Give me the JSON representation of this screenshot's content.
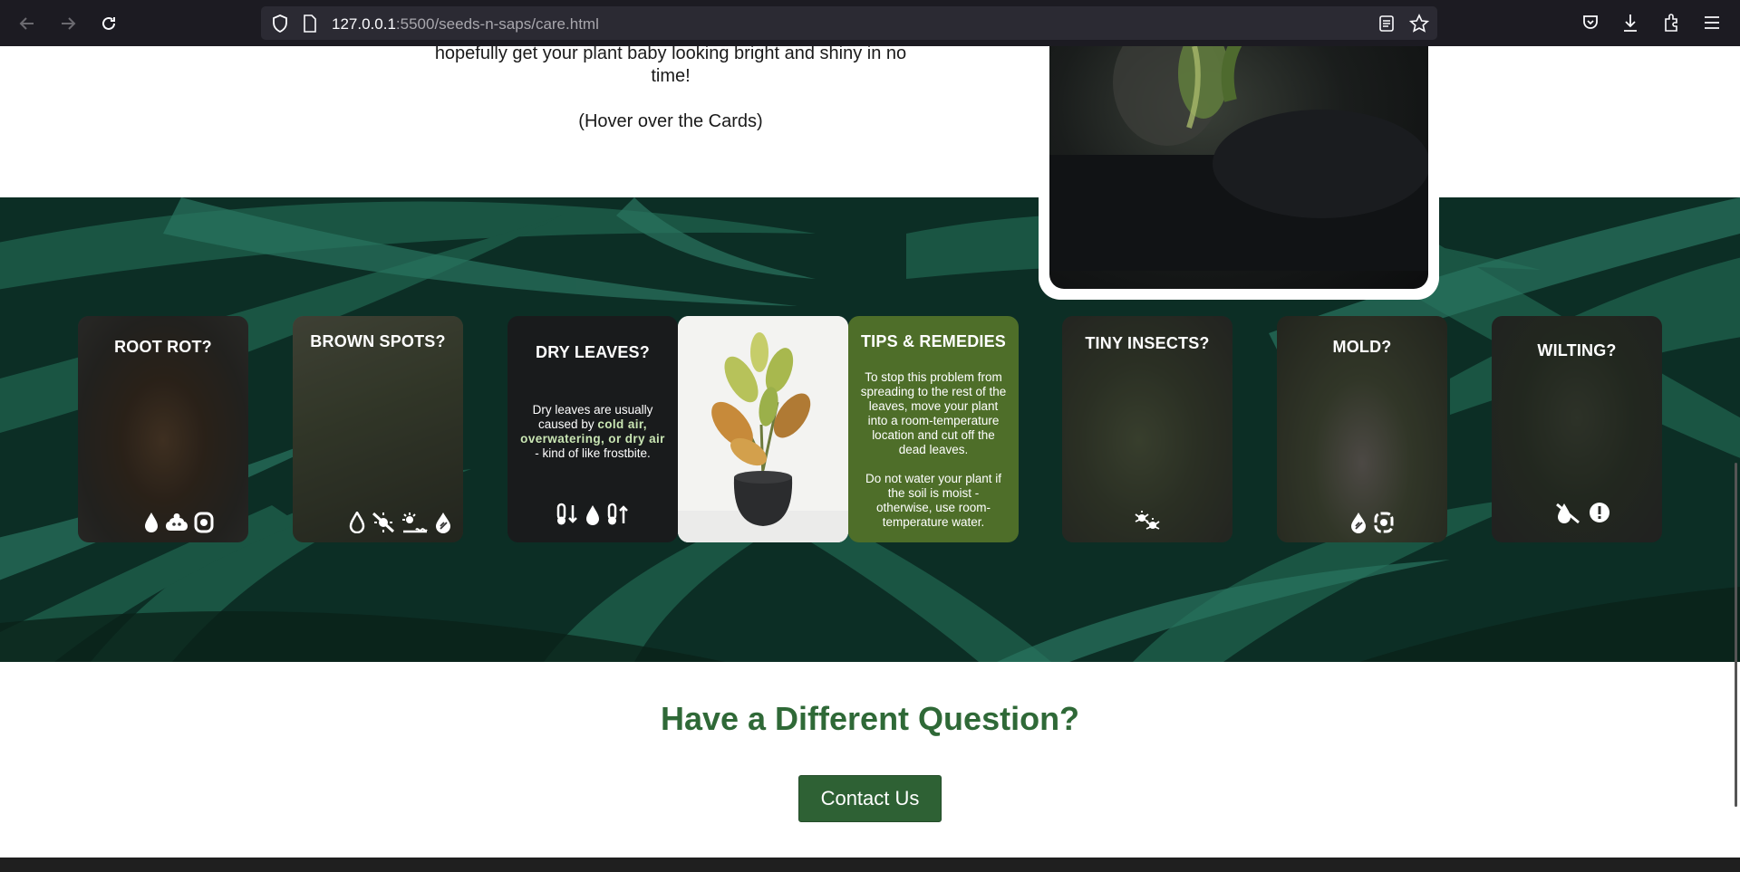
{
  "browser": {
    "url_host": "127.0.0.1",
    "url_path": ":5500/seeds-n-saps/care.html"
  },
  "intro": {
    "line1": "hopefully get your plant baby looking bright and shiny in no time!",
    "hint": "(Hover over the Cards)"
  },
  "cards": [
    {
      "title": "ROOT ROT?",
      "icons": [
        "water-drop-icon",
        "poop-icon",
        "fungus-icon"
      ]
    },
    {
      "title": "BROWN SPOTS?",
      "icons": [
        "water-drop-icon",
        "no-sun-icon",
        "sun-heat-icon",
        "water-temperature-icon"
      ]
    },
    {
      "title": "DRY LEAVES?",
      "desc_start": "Dry leaves are usually caused by ",
      "desc_bold": "cold air, overwatering, or dry air",
      "desc_end": " - kind of like frostbite.",
      "icons": [
        "temperature-down-icon",
        "water-drop-icon",
        "temperature-up-icon"
      ]
    },
    {
      "title": "TINY INSECTS?",
      "icons": [
        "bugs-icon"
      ]
    },
    {
      "title": "MOLD?",
      "icons": [
        "water-temperature-icon",
        "fungus-icon"
      ]
    },
    {
      "title": "WILTING?",
      "icons": [
        "no-sun-icon",
        "warning-icon"
      ]
    }
  ],
  "tips": {
    "title": "TIPS & REMEDIES",
    "para1": "To stop this problem from spreading to the rest of the leaves, move your plant into a room-temperature location and cut off the dead leaves.",
    "para2": "Do not water your plant if the soil is moist - otherwise, use room-temperature water."
  },
  "question": {
    "heading": "Have a Different Question?",
    "button": "Contact Us"
  },
  "colors": {
    "accent_green": "#2f6937",
    "tips_green": "#4e6e29",
    "band_green": "#0d3328"
  }
}
